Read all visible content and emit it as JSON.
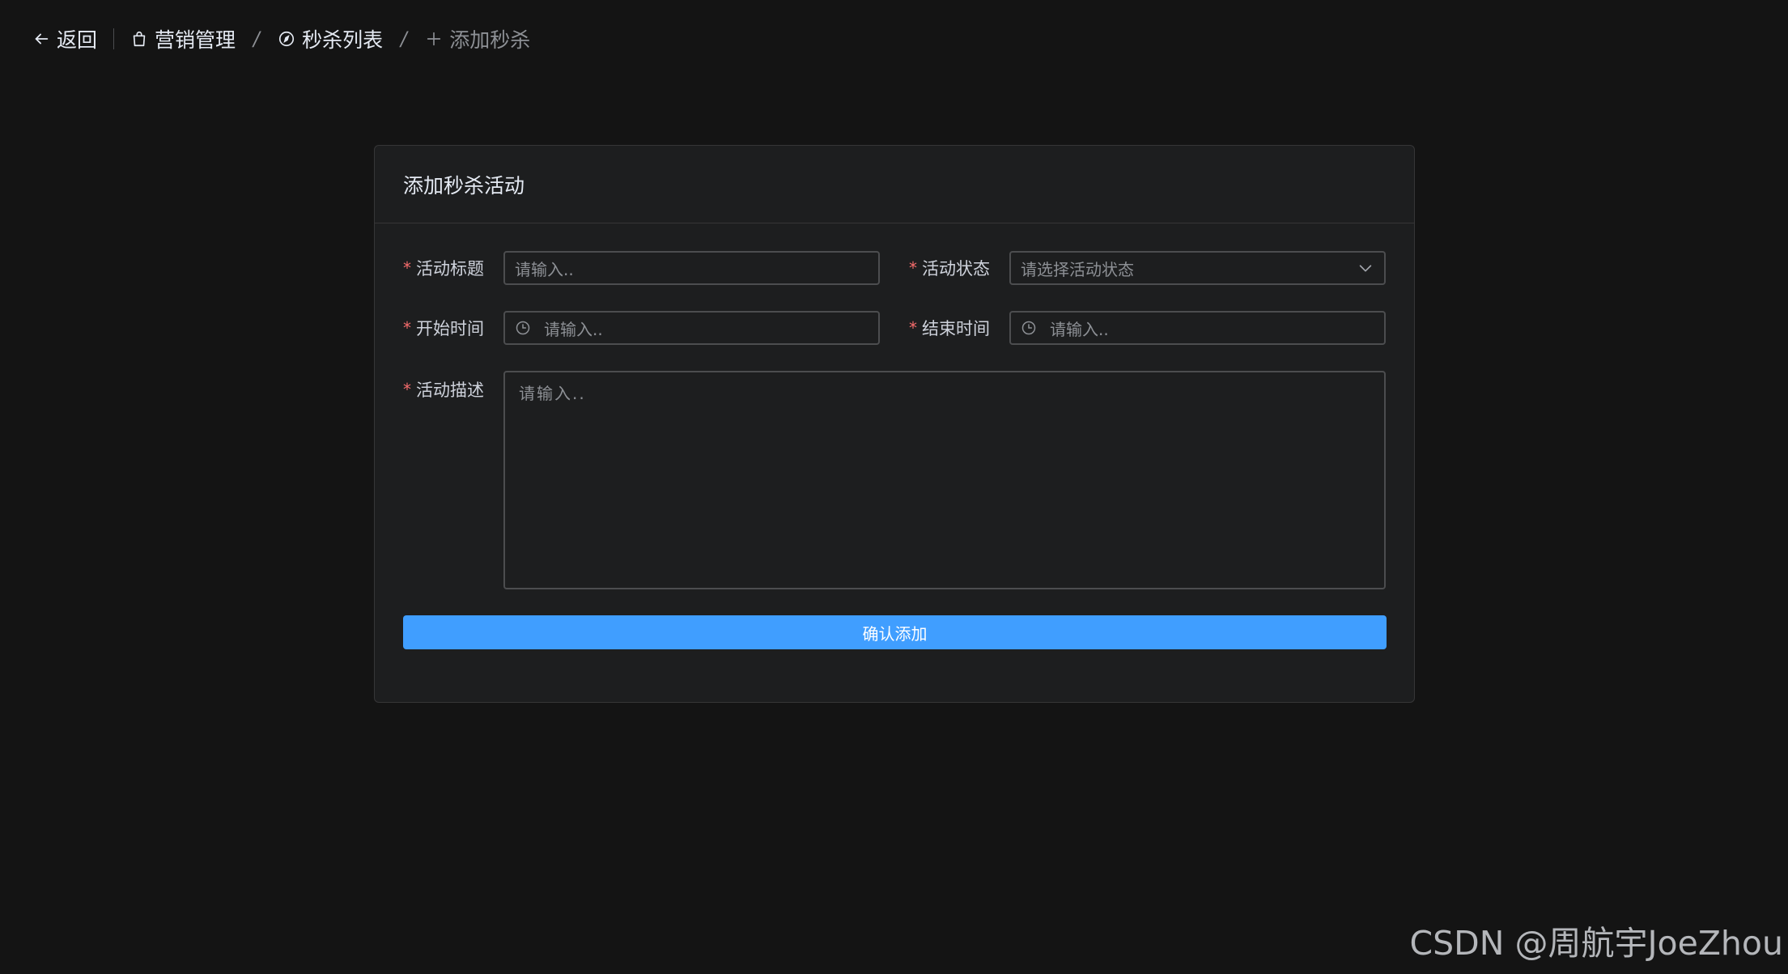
{
  "breadcrumb": {
    "back_label": "返回",
    "items": [
      {
        "label": "营销管理",
        "icon": "shopping-bag-icon"
      },
      {
        "label": "秒杀列表",
        "icon": "compass-icon"
      },
      {
        "label": "添加秒杀",
        "icon": "plus-icon"
      }
    ],
    "separator": "/"
  },
  "card": {
    "title": "添加秒杀活动"
  },
  "form": {
    "required_mark": "*",
    "title": {
      "label": "活动标题",
      "placeholder": "请输入.."
    },
    "status": {
      "label": "活动状态",
      "placeholder": "请选择活动状态"
    },
    "start_time": {
      "label": "开始时间",
      "placeholder": "请输入.."
    },
    "end_time": {
      "label": "结束时间",
      "placeholder": "请输入.."
    },
    "description": {
      "label": "活动描述",
      "placeholder": "请输入.."
    },
    "submit_label": "确认添加"
  },
  "watermark": "CSDN @周航宇JoeZhou",
  "colors": {
    "background": "#141414",
    "card": "#1d1e1f",
    "primary": "#409eff",
    "required": "#f56c6c"
  }
}
